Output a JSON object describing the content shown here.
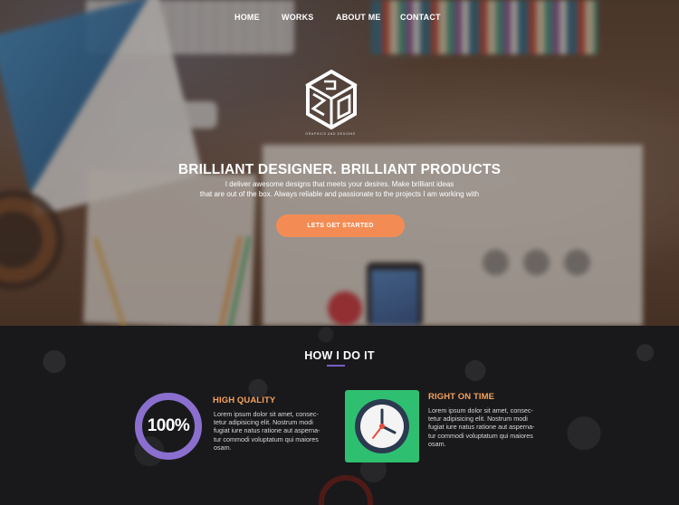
{
  "nav": {
    "items": [
      "HOME",
      "WORKS",
      "ABOUT ME",
      "CONTACT"
    ]
  },
  "hero": {
    "logo_tagline": "GRAPHICS AND DESIGNS",
    "headline": "BRILLIANT DESIGNER. BRILLIANT PRODUCTS",
    "subtext_line1": "I deliver awesome designs that meets your desires. Make brilliant ideas",
    "subtext_line2": "that are out of the box. Always reliable and passionate to the projects I am working with",
    "cta_label": "LETS GET STARTED"
  },
  "how": {
    "title": "HOW I DO IT",
    "features": [
      {
        "title": "HIGH QUALITY",
        "badge": "100%",
        "progress": 1.0,
        "lines": [
          "Lorem ipsum dolor sit amet, consec-",
          "tetur adipisicing elit. Nostrum modi",
          "fugiat iure natus ratione aut asperna-",
          "tur commodi voluptatum qui maiores",
          "osam."
        ]
      },
      {
        "title": "RIGHT ON TIME",
        "lines": [
          "Lorem ipsum dolor sit amet, consec-",
          "tetur adipisicing elit. Nostrum modi",
          "fugiat iure natus ratione aut asperna-",
          "tur commodi voluptatum qui maiores",
          "osam."
        ]
      }
    ]
  },
  "colors": {
    "accent_orange": "#f38c54",
    "feature_title": "#f5a25d",
    "ring_purple": "#8a6fcf",
    "clock_green": "#2fbf71",
    "underline": "#7a5ec8"
  },
  "icons": [
    "cube-logo-icon",
    "progress-ring-icon",
    "clock-icon"
  ]
}
